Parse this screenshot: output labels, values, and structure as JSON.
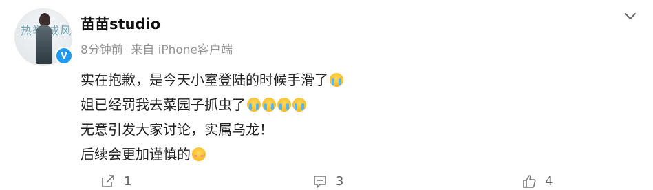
{
  "post": {
    "username": "苗苗studio",
    "time": "8分钟前",
    "source": "来自 iPhone客户端",
    "lines": [
      "实在抱歉，是今天小室登陆的时候手滑了",
      "姐已经罚我去菜园子抓虫了",
      "无意引发大家讨论，实属乌龙！",
      "后续会更加谨慎的"
    ]
  },
  "avatar": {
    "decorative_text": "热举 成风",
    "badge": "V"
  },
  "actions": {
    "share_count": "1",
    "comment_count": "3",
    "like_count": "4"
  },
  "icons": {
    "more": "chevron-down-icon",
    "share": "share-icon",
    "comment": "comment-icon",
    "like": "like-icon",
    "emoji_cry": "crying-emoji-icon",
    "emoji_shy": "shy-emoji-icon"
  },
  "colors": {
    "verified": "#1d9bf0",
    "meta_text": "#939393",
    "text": "#222222"
  }
}
